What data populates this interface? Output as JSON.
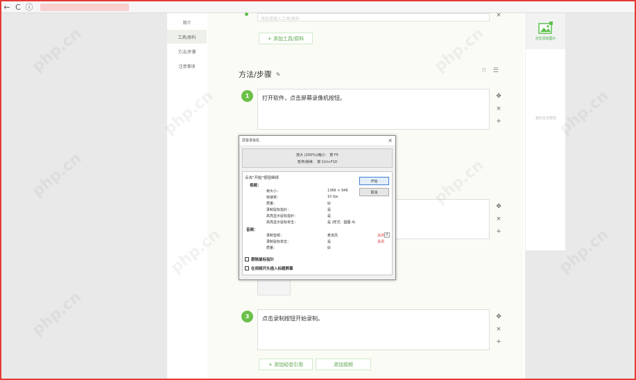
{
  "browser": {
    "back": "←",
    "reload": "C",
    "info": "ⓘ"
  },
  "left_nav": [
    "简介",
    "工具/原料",
    "方法/步骤",
    "注意事项"
  ],
  "tools": {
    "placeholder": "添加或输入工具/原料",
    "add_btn": "+ 添加工具/原料"
  },
  "section": {
    "title": "方法/步骤"
  },
  "steps": [
    {
      "num": "1",
      "text": "打开软件，点击屏幕录像机按钮。"
    },
    {
      "num": "3",
      "text": "点击录制按钮开始录制。"
    }
  ],
  "right_panel": {
    "upload": "点击添加图片",
    "note": "暂时无法预览"
  },
  "bottom": {
    "add_step": "+ 添加经验引用",
    "add_video": "添加视频"
  },
  "dialog": {
    "title": "屏幕录像机",
    "close": "×",
    "hotkey1": "放大 (200%)/缩小： 按 F5",
    "hotkey2": "暂停/继续： 按 Ctrl+F10",
    "prompt": "点击\"开始\"按钮继续",
    "start": "开始",
    "cancel": "取消",
    "video_title": "视频：",
    "video_rows": [
      {
        "k": "帧大小：",
        "v": "1366 × 946"
      },
      {
        "k": "帧速率：",
        "v": "10 fps"
      },
      {
        "k": "质量：",
        "v": "好"
      },
      {
        "k": "录制鼠标指针：",
        "v": "是"
      },
      {
        "k": "高亮显示鼠标指针：",
        "v": "是"
      },
      {
        "k": "高亮显示鼠标单击：",
        "v": "是 (样式：圆圈 4)"
      }
    ],
    "audio_title": "音频：",
    "audio_rows": [
      {
        "k": "录制音频：",
        "v": "麦克风",
        "act": "关闭"
      },
      {
        "k": "录制鼠标单击：",
        "v": "是",
        "act": "关闭"
      },
      {
        "k": "质量：",
        "v": "好"
      }
    ],
    "help": "?",
    "check1": "跟随鼠标指针",
    "check2": "在视频开头插入标题屏幕"
  },
  "icons": {
    "move": "✥",
    "close": "×",
    "add": "+",
    "pencil": "✎",
    "list": "☰"
  }
}
